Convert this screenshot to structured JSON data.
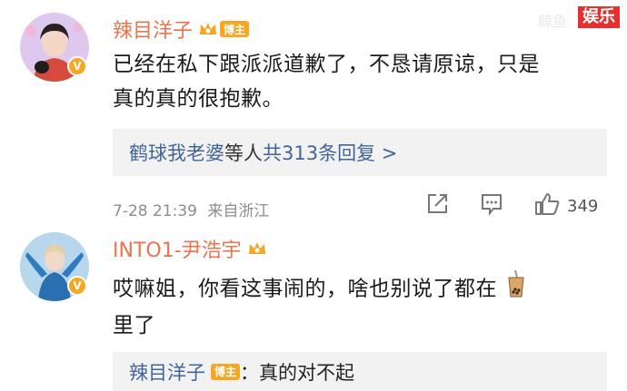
{
  "watermark": {
    "label": "娱乐",
    "ghost": "鲸鱼"
  },
  "comments": [
    {
      "author": "辣目洋子",
      "badge": "博主",
      "verified": "V",
      "text_line1": "已经在私下跟派派道歉了，不恳请原谅，只是",
      "text_line2": "真的真的很抱歉。",
      "reply_summary": {
        "users": "鹤球我老婆",
        "middle": "等人 ",
        "count_text": "共313条回复 >"
      },
      "time": "7-28 21:39",
      "location": "来自浙江",
      "likes": "349"
    },
    {
      "author": "INTO1-尹浩宇",
      "verified": "V",
      "text_line1": "哎嘛姐，你看这事闹的，啥也别说了都在",
      "text_line2": "里了",
      "emoji": "boba-tea-icon",
      "sub_reply": {
        "author": "辣目洋子",
        "badge": "博主",
        "separator": "：",
        "text": "真的对不起"
      }
    }
  ],
  "colors": {
    "name": "#eb7350",
    "link": "#406599",
    "badge": "#f5a623",
    "watermark": "#e4312f"
  }
}
